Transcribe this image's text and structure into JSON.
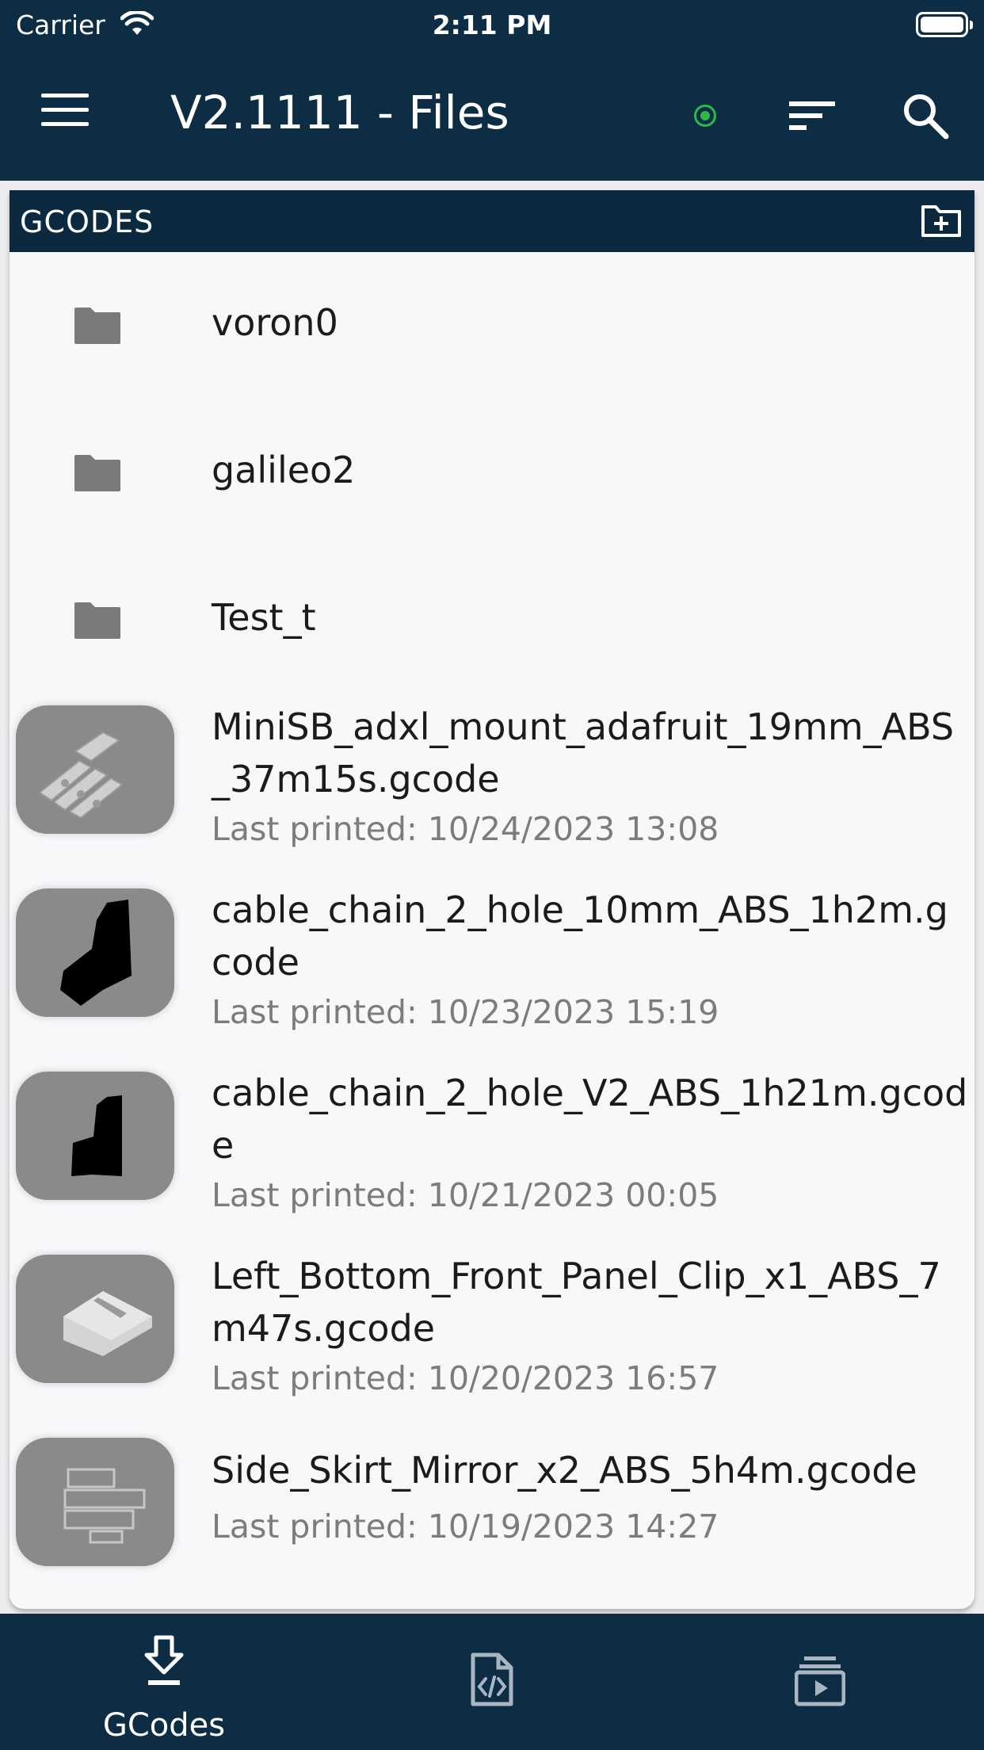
{
  "status_bar": {
    "carrier": "Carrier",
    "time": "2:11 PM"
  },
  "app_bar": {
    "title": "V2.1111 - Files",
    "connection_color": "#2db84a",
    "icons": [
      "menu-icon",
      "connection-status-icon",
      "sort-icon",
      "search-icon"
    ]
  },
  "files": {
    "header": "GCODES",
    "header_icon": "create-folder-icon",
    "folders": [
      {
        "name": "voron0"
      },
      {
        "name": "galileo2"
      },
      {
        "name": "Test_t"
      }
    ],
    "gcodes": [
      {
        "name": "MiniSB_adxl_mount_adafruit_19mm_ABS_37m15s.gcode",
        "last_printed": "Last printed: 10/24/2023 13:08"
      },
      {
        "name": "cable_chain_2_hole_10mm_ABS_1h2m.gcode",
        "last_printed": "Last printed: 10/23/2023 15:19"
      },
      {
        "name": "cable_chain_2_hole_V2_ABS_1h21m.gcode",
        "last_printed": "Last printed: 10/21/2023 00:05"
      },
      {
        "name": "Left_Bottom_Front_Panel_Clip_x1_ABS_7m47s.gcode",
        "last_printed": "Last printed: 10/20/2023 16:57"
      },
      {
        "name": "Side_Skirt_Mirror_x2_ABS_5h4m.gcode",
        "last_printed": "Last printed: 10/19/2023 14:27"
      }
    ]
  },
  "bottom_nav": {
    "items": [
      {
        "label": "GCodes",
        "icon": "gcode-download-icon",
        "selected": true
      },
      {
        "label": "",
        "icon": "config-file-icon",
        "selected": false
      },
      {
        "label": "",
        "icon": "timelapse-icon",
        "selected": false
      }
    ]
  },
  "colors": {
    "primary_navy": "#0d2d45",
    "card_background": "#f8f8fb",
    "secondary_text": "#7c7c7c"
  }
}
